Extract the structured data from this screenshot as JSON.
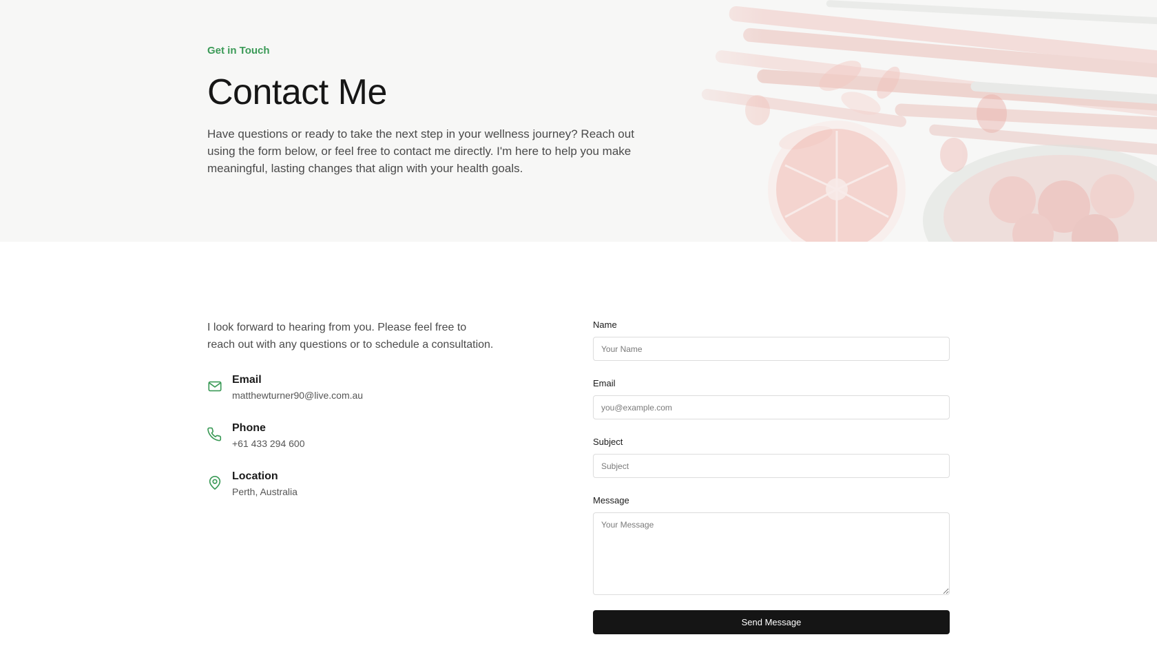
{
  "hero": {
    "eyebrow": "Get in Touch",
    "title": "Contact Me",
    "description": "Have questions or ready to take the next step in your wellness journey? Reach out using the form below, or feel free to contact me directly. I'm here to help you make meaningful, lasting changes that align with your health goals."
  },
  "info": {
    "intro": "I look forward to hearing from you. Please feel free to reach out with any questions or to schedule a consultation.",
    "items": [
      {
        "label": "Email",
        "value": "matthewturner90@live.com.au",
        "icon": "mail-icon"
      },
      {
        "label": "Phone",
        "value": "+61 433 294 600",
        "icon": "phone-icon"
      },
      {
        "label": "Location",
        "value": "Perth, Australia",
        "icon": "map-pin-icon"
      }
    ]
  },
  "form": {
    "name": {
      "label": "Name",
      "placeholder": "Your Name"
    },
    "email": {
      "label": "Email",
      "placeholder": "you@example.com"
    },
    "subject": {
      "label": "Subject",
      "placeholder": "Subject"
    },
    "message": {
      "label": "Message",
      "placeholder": "Your Message"
    },
    "submit_label": "Send Message"
  },
  "colors": {
    "accent": "#3b9a57",
    "button": "#151515",
    "hero_bg": "#f7f7f6"
  }
}
